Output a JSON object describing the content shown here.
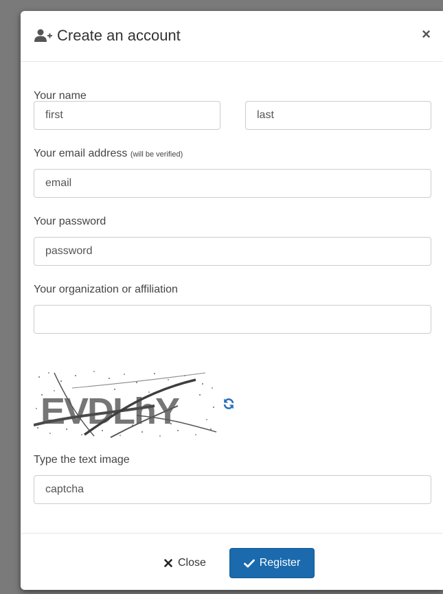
{
  "modal": {
    "title": "Create an account",
    "close_symbol": "×",
    "header_icon": "user-plus-icon"
  },
  "form": {
    "name_label": "Your name",
    "first_placeholder": "first",
    "last_placeholder": "last",
    "email_label": "Your email address",
    "email_note": "(will be verified)",
    "email_placeholder": "email",
    "password_label": "Your password",
    "password_placeholder": "password",
    "organization_label": "Your organization or affiliation",
    "organization_placeholder": "",
    "captcha_text": "EVDLhY",
    "captcha_label": "Type the text image",
    "captcha_placeholder": "captcha"
  },
  "footer": {
    "close_label": "Close",
    "register_label": "Register"
  },
  "colors": {
    "primary": "#1a6aad",
    "refresh_icon": "#2a6fb8",
    "overlay": "#7a7a7a"
  }
}
